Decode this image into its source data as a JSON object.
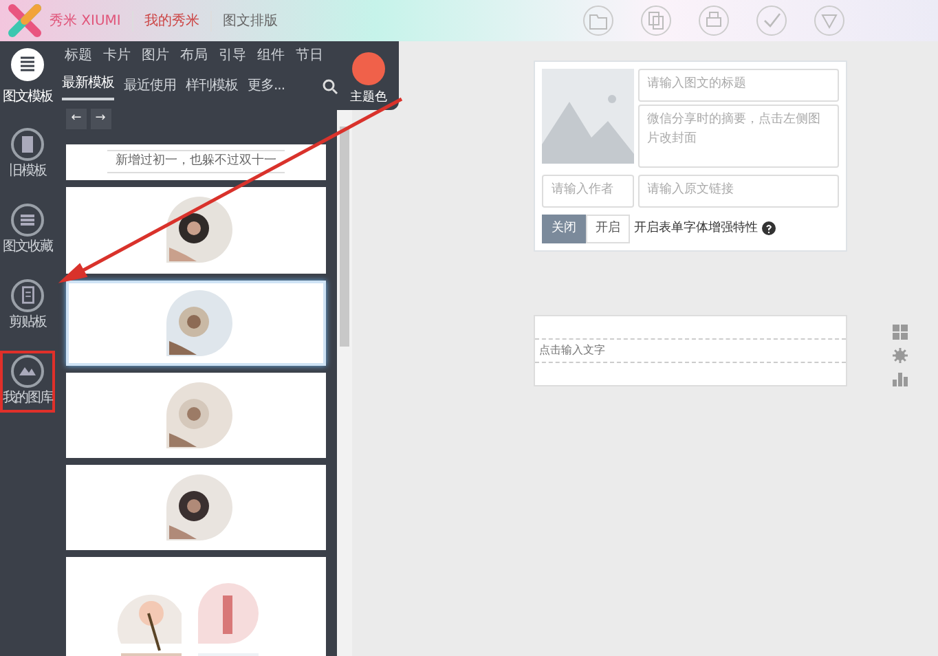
{
  "topbar": {
    "brand": "秀米 XIUMI",
    "links": [
      "我的秀米",
      "图文排版"
    ],
    "actions": [
      {
        "kind": "folder"
      },
      {
        "kind": "copy"
      },
      {
        "kind": "print"
      },
      {
        "kind": "check"
      },
      {
        "kind": "triangle"
      }
    ]
  },
  "panel": {
    "home": {
      "label": "图文模板",
      "selected": true
    },
    "categories": [
      "标题",
      "卡片",
      "图片",
      "布局",
      "引导",
      "组件",
      "节日"
    ],
    "subtabs": [
      {
        "label": "最新模板",
        "selected": true
      },
      {
        "label": "最近使用",
        "selected": false
      },
      {
        "label": "样刊模板",
        "selected": false
      },
      {
        "label": "更多...",
        "selected": false
      }
    ],
    "theme": {
      "label": "主题色",
      "color": "#f0614a"
    },
    "pager": [
      "←",
      "→"
    ],
    "sidebar": [
      {
        "label": "旧模板",
        "kind": "doc",
        "marked": false
      },
      {
        "label": "图文收藏",
        "kind": "stack",
        "marked": false
      },
      {
        "label": "剪贴板",
        "kind": "clip",
        "marked": false
      },
      {
        "label": "我的图库",
        "kind": "gallery",
        "marked": true
      }
    ],
    "templates": [
      {
        "kind": "text",
        "text": "新增过初一，也躲不过双十一",
        "selected": false
      },
      {
        "kind": "picture",
        "selected": false
      },
      {
        "kind": "picture",
        "selected": true
      },
      {
        "kind": "picture",
        "selected": false
      },
      {
        "kind": "picture",
        "selected": false
      },
      {
        "kind": "grid",
        "selected": false
      }
    ]
  },
  "article": {
    "title": {
      "placeholder": "请输入图文的标题"
    },
    "summary": {
      "placeholder": "微信分享时的摘要，点击左侧图片改封面"
    },
    "author": {
      "placeholder": "请输入作者"
    },
    "link": {
      "placeholder": "请输入原文链接"
    },
    "toggle": [
      {
        "label": "关闭",
        "selected": true
      },
      {
        "label": "开启",
        "selected": false
      }
    ],
    "toggle_label": "开启表单字体增强特性"
  },
  "editor": {
    "placeholder": "点击输入文字"
  },
  "tools": [
    {
      "kind": "grid"
    },
    {
      "kind": "gear"
    },
    {
      "kind": "chart"
    }
  ]
}
